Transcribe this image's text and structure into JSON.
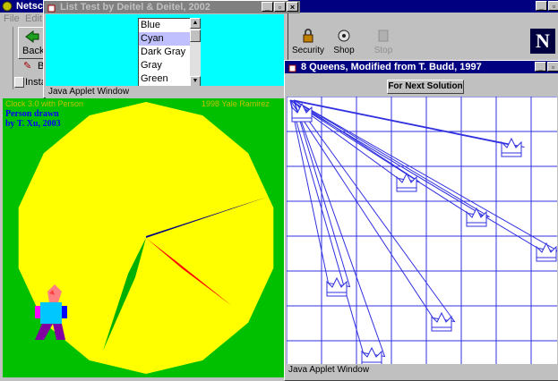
{
  "netscape": {
    "title": "Netsca",
    "menu": [
      "File",
      "Edit"
    ],
    "back_label": "Back",
    "bookmarks_label": "B",
    "instant_label": "Insta",
    "toolbar": [
      {
        "label": "Security",
        "icon": "lock-icon"
      },
      {
        "label": "Shop",
        "icon": "shop-icon"
      },
      {
        "label": "Stop",
        "icon": "stop-icon"
      }
    ],
    "logo_letter": "N"
  },
  "list_window": {
    "title": "List Test by Deitel & Deitel, 2002",
    "items": [
      "Blue",
      "Cyan",
      "Dark Gray",
      "Gray",
      "Green"
    ],
    "selected": "Cyan",
    "status": "Java Applet Window"
  },
  "clock_applet": {
    "header_left": "Clock 3.0 with Person",
    "header_right": "1998 Yale Ramirez",
    "person_caption_line1": "Person drawn",
    "person_caption_line2": "by T. Xu, 2003",
    "hands": [
      {
        "name": "hour",
        "color": "#ff0000"
      },
      {
        "name": "minute",
        "color": "#00b000"
      },
      {
        "name": "second",
        "color": "#000080"
      }
    ],
    "face_color": "#ffff00",
    "background_color": "#00c000"
  },
  "queens_window": {
    "title": "8 Queens, Modified from T. Budd, 1997",
    "button_label": "For Next Solution",
    "status": "Java Applet Window",
    "line_color": "#3030e0",
    "queens": [
      {
        "row": 0,
        "col": 0
      },
      {
        "row": 1,
        "col": 6
      },
      {
        "row": 2,
        "col": 3
      },
      {
        "row": 3,
        "col": 5
      },
      {
        "row": 4,
        "col": 7
      },
      {
        "row": 5,
        "col": 1
      },
      {
        "row": 6,
        "col": 4
      },
      {
        "row": 7,
        "col": 2
      }
    ]
  }
}
